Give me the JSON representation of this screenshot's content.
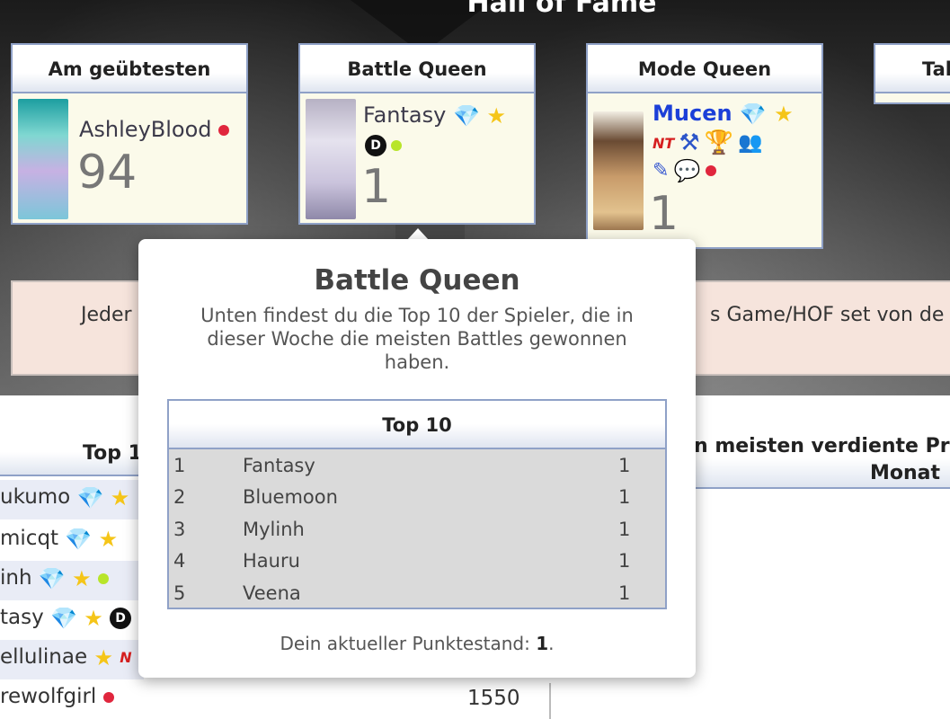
{
  "page": {
    "title": "Hall of Fame"
  },
  "cards": [
    {
      "title": "Am geübtesten",
      "user": "AshleyBlood",
      "score": "94"
    },
    {
      "title": "Battle Queen",
      "user": "Fantasy",
      "score": "1"
    },
    {
      "title": "Mode Queen",
      "user": "Mucen",
      "score": "1"
    },
    {
      "title": "Tal"
    }
  ],
  "info": {
    "left": "Jeder",
    "right": "s Game/HOF set von de"
  },
  "left_table": {
    "header": "Top 1",
    "rows": [
      {
        "name": "ukumo"
      },
      {
        "name": "micqt"
      },
      {
        "name": "inh"
      },
      {
        "name": "tasy"
      },
      {
        "name": "ellulinae"
      },
      {
        "name": "rewolfgirl",
        "score": "1550"
      }
    ]
  },
  "right_table": {
    "header_line1": "n meisten verdiente Pr",
    "header_line2": "Monat"
  },
  "popover": {
    "title": "Battle Queen",
    "description": "Unten findest du die Top 10 der Spieler, die in dieser Woche die meisten Battles gewonnen haben.",
    "table_title": "Top 10",
    "rows": [
      {
        "rank": "1",
        "name": "Fantasy",
        "value": "1"
      },
      {
        "rank": "2",
        "name": "Bluemoon",
        "value": "1"
      },
      {
        "rank": "3",
        "name": "Mylinh",
        "value": "1"
      },
      {
        "rank": "4",
        "name": "Hauru",
        "value": "1"
      },
      {
        "rank": "5",
        "name": "Veena",
        "value": "1"
      }
    ],
    "footer_prefix": "Dein aktueller Punktestand: ",
    "footer_value": "1",
    "footer_suffix": "."
  },
  "icons": {
    "status": "status-dot-icon",
    "diamond": "diamond-icon",
    "star": "star-icon"
  },
  "colors": {
    "card_bg": "#fbfaea",
    "card_border": "#8fa1c7",
    "info_bg": "#f6e4dc",
    "user_blue": "#1b3fd8",
    "status_red": "#e0263d",
    "status_green": "#b8e52a"
  }
}
